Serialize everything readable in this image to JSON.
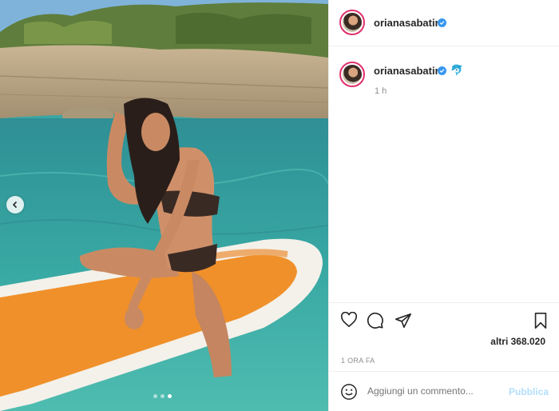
{
  "post": {
    "username": "orianasabatini",
    "caption_emoji": "🐬",
    "caption_time": "1 h",
    "likes": "altri 368.020",
    "posted_ago": "1 ORA FA",
    "carousel": {
      "total": 3,
      "active_index": 2
    }
  },
  "comment": {
    "placeholder": "Aggiungi un commento...",
    "publish_label": "Pubblica"
  },
  "icons": {
    "prev": "chevron-left-icon",
    "like": "heart-icon",
    "comment": "comment-bubble-icon",
    "share": "paper-plane-icon",
    "save": "bookmark-icon",
    "emoji": "smiley-icon",
    "verified": "verified-badge-icon"
  },
  "colors": {
    "verified": "#3897f0",
    "story_ring": "#e1306c",
    "publish_disabled": "#b2dffc",
    "muted_text": "#8e8e8e"
  }
}
